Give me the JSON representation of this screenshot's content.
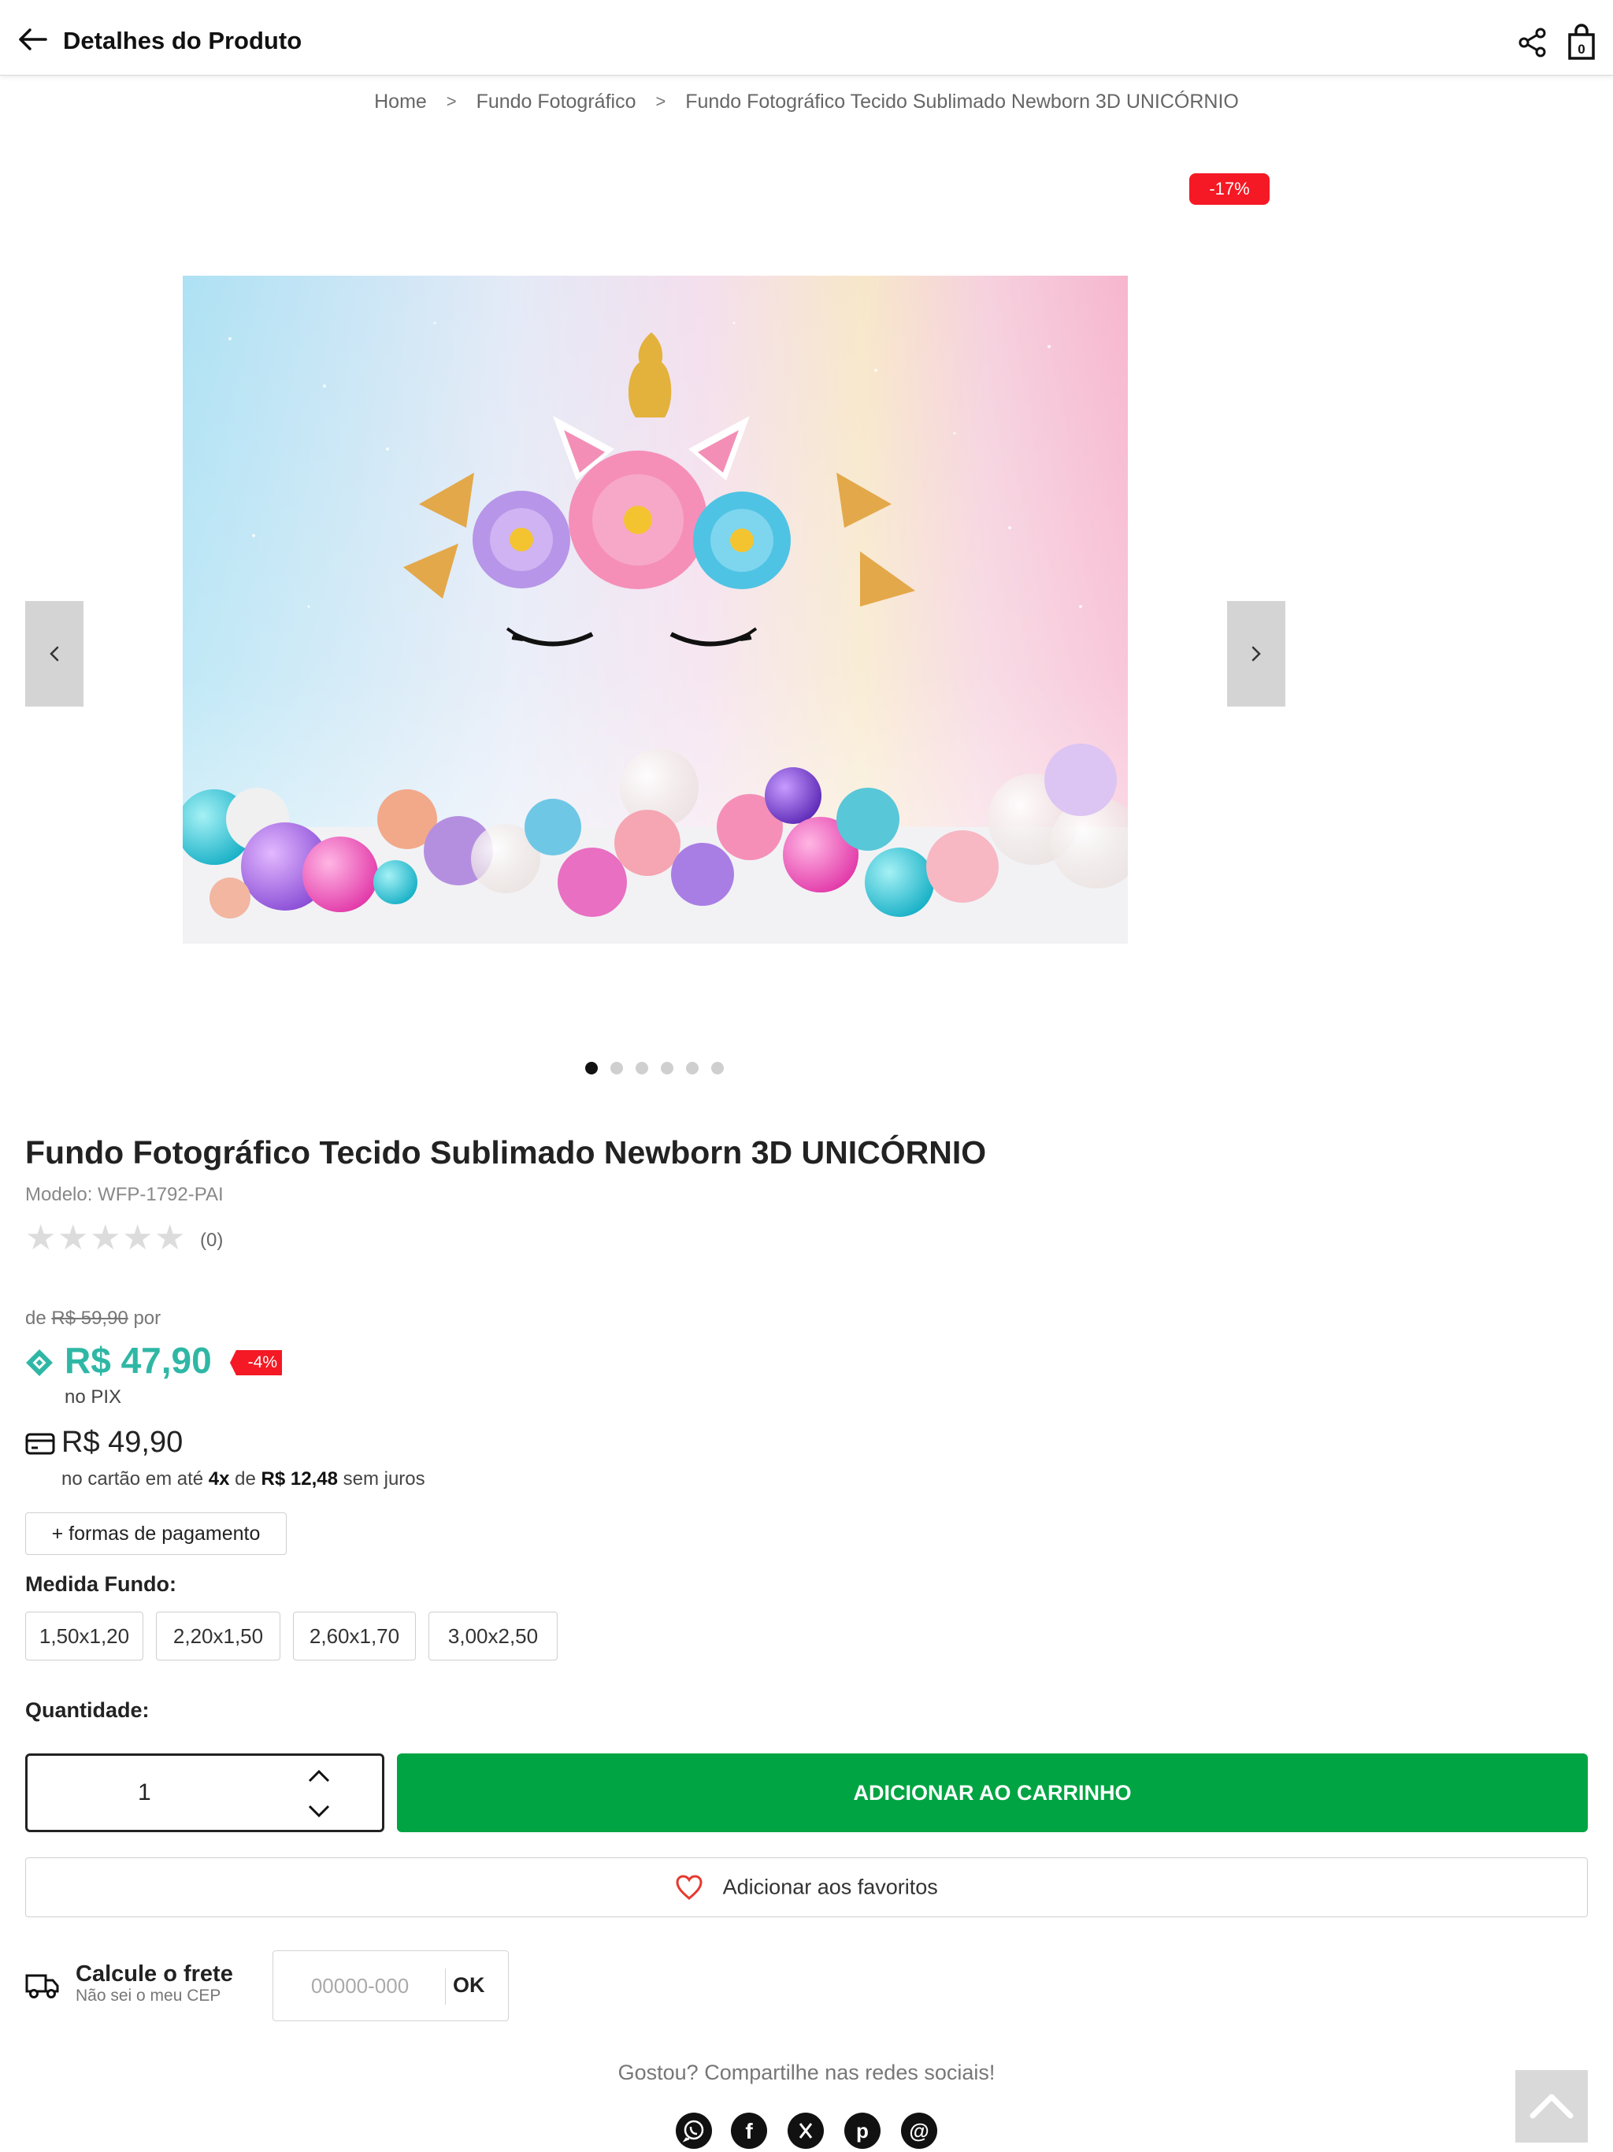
{
  "header": {
    "title": "Detalhes do Produto"
  },
  "breadcrumb": [
    "Home",
    "Fundo Fotográfico",
    "Fundo Fotográfico Tecido Sublimado Newborn 3D UNICÓRNIO"
  ],
  "breadcrumb_sep": ">",
  "gallery": {
    "discount_badge": "-17%",
    "slide_count": 6,
    "active_slide": 1
  },
  "product": {
    "title": "Fundo Fotográfico Tecido Sublimado Newborn 3D UNICÓRNIO",
    "model": "Modelo: WFP-1792-PAI",
    "rating": 0,
    "rating_max": 5,
    "reviews": "(0)"
  },
  "price": {
    "de_prefix": "de",
    "old": "R$ 59,90",
    "por": "por",
    "pix_value": "R$ 47,90",
    "pix_discount": "-4%",
    "pix_label": "no PIX",
    "card_value": "R$ 49,90",
    "card_prefix": "no cartão em até",
    "card_installments": "4x",
    "card_de": "de",
    "card_installment_value": "R$ 12,48",
    "card_suffix": "sem juros"
  },
  "payment_button": "+ formas de pagamento",
  "medida": {
    "label": "Medida Fundo:",
    "options": [
      "1,50x1,20",
      "2,20x1,50",
      "2,60x1,70",
      "3,00x2,50"
    ]
  },
  "quantity": {
    "label": "Quantidade:",
    "value": "1"
  },
  "add_to_cart": "ADICIONAR AO CARRINHO",
  "favorites": "Adicionar aos favoritos",
  "frete": {
    "title": "Calcule o frete",
    "link": "Não sei o meu CEP",
    "placeholder": "00000-000",
    "ok": "OK"
  },
  "share": {
    "text": "Gostou? Compartilhe nas redes sociais!",
    "networks": [
      "whatsapp-icon",
      "facebook-icon",
      "x-icon",
      "pinterest-icon",
      "email-icon"
    ]
  },
  "colors": {
    "accent_green": "#00a443",
    "pix_teal": "#2fb7a5",
    "discount_red": "#f41924"
  }
}
